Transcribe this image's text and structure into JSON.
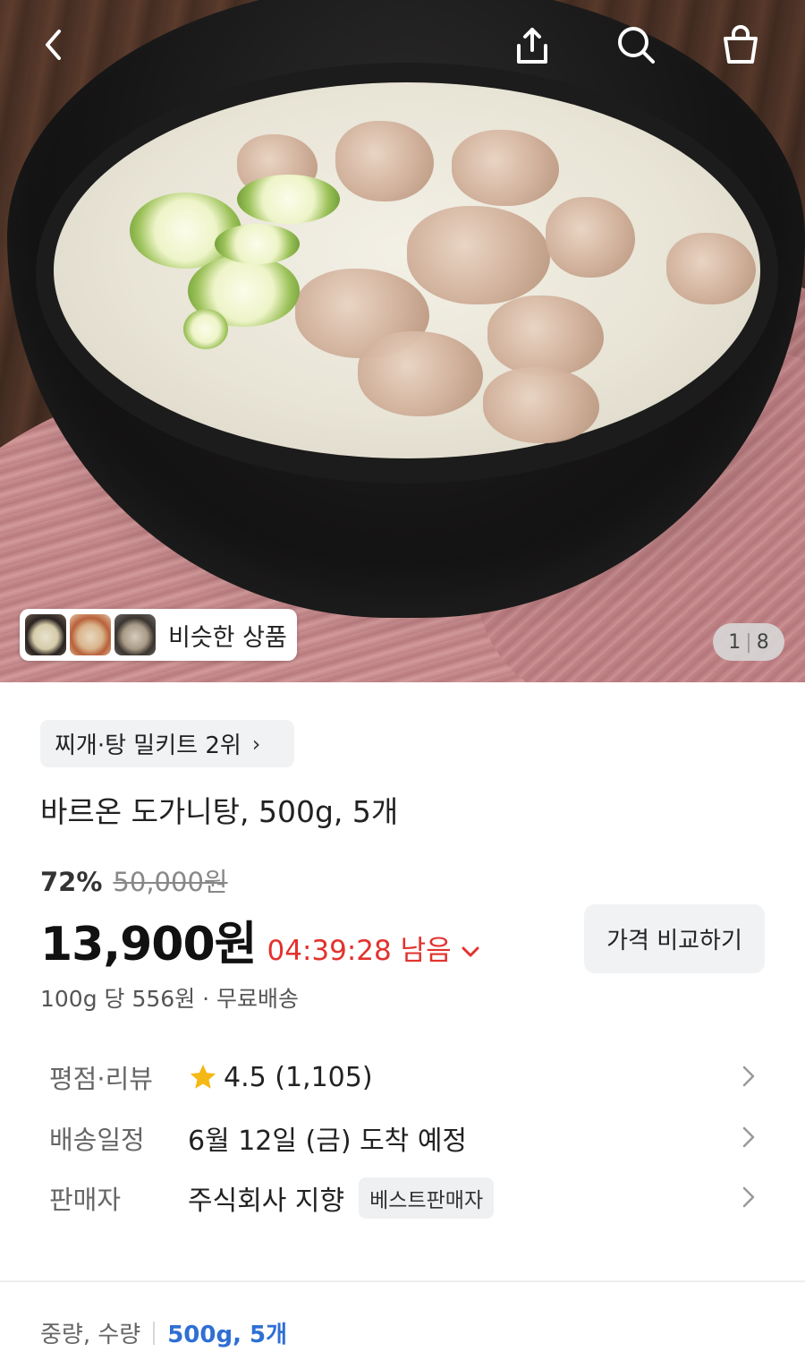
{
  "hero": {
    "similar_label": "비슷한 상품",
    "pager_current": "1",
    "pager_total": "8"
  },
  "topbar": {
    "icons": [
      "chevron-left-icon",
      "share-icon",
      "search-icon",
      "cart-icon"
    ]
  },
  "product": {
    "rank_label": "찌개·탕 밀키트 2위",
    "title": "바르온 도가니탕, 500g, 5개",
    "discount": "72%",
    "original_price": "50,000원",
    "price": "13,900원",
    "timer": "04:39:28 남음",
    "compare_button": "가격 비교하기",
    "unit_info": "100g 당 556원 · 무료배송"
  },
  "details": {
    "rating_label": "평점·리뷰",
    "rating_value": "4.5 (1,105)",
    "delivery_label": "배송일정",
    "delivery_value": "6월 12일 (금) 도착 예정",
    "seller_label": "판매자",
    "seller_value": "주식회사 지향",
    "seller_badge": "베스트판매자"
  },
  "options": {
    "label": "중량, 수량",
    "value": "500g, 5개"
  },
  "colors": {
    "timer": "#e2322d",
    "option_value": "#2f6fd4",
    "star": "#f5b814"
  }
}
